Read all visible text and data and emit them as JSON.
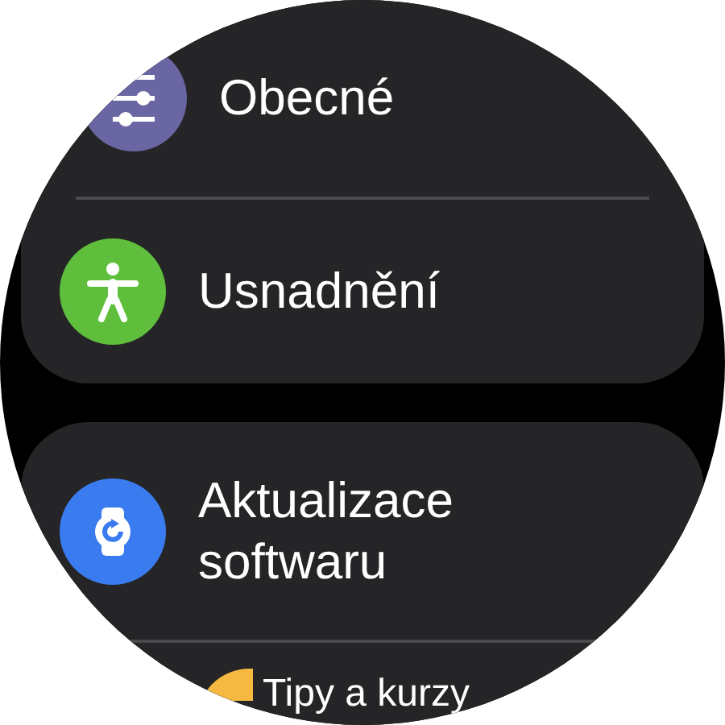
{
  "groups": [
    {
      "items": [
        {
          "label": "Obecné",
          "color": "#6a66a3"
        },
        {
          "label": "Usnadnění",
          "color": "#5fbf3c"
        }
      ]
    },
    {
      "items": [
        {
          "label": "Aktualizace softwaru",
          "color": "#3a7bf0"
        },
        {
          "label": "Tipy a kurzy",
          "color": "#f5b942"
        }
      ]
    }
  ]
}
